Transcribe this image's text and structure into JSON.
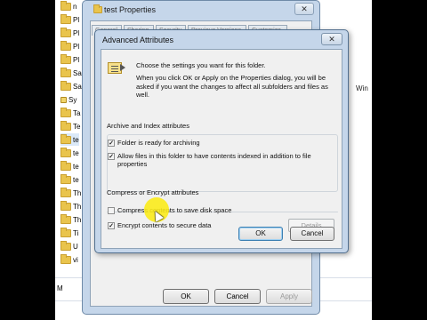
{
  "explorer": {
    "items": [
      {
        "label": "n",
        "icon": "folder"
      },
      {
        "label": "Pl",
        "icon": "folder"
      },
      {
        "label": "Pl",
        "icon": "folder"
      },
      {
        "label": "Pl",
        "icon": "folder"
      },
      {
        "label": "Pl",
        "icon": "folder"
      },
      {
        "label": "Sa",
        "icon": "folder"
      },
      {
        "label": "Sa",
        "icon": "folder"
      },
      {
        "label": "Sy",
        "icon": "lock"
      },
      {
        "label": "Ta",
        "icon": "folder"
      },
      {
        "label": "Te",
        "icon": "folder"
      },
      {
        "label": "te",
        "icon": "folder"
      },
      {
        "label": "te",
        "icon": "folder"
      },
      {
        "label": "te",
        "icon": "folder"
      },
      {
        "label": "te",
        "icon": "folder"
      },
      {
        "label": "Th",
        "icon": "folder"
      },
      {
        "label": "Th",
        "icon": "folder"
      },
      {
        "label": "Th",
        "icon": "folder"
      },
      {
        "label": "Ti",
        "icon": "folder"
      },
      {
        "label": "U",
        "icon": "folder"
      },
      {
        "label": "vi",
        "icon": "folder"
      }
    ],
    "selected_index": 10,
    "bottom_label": "M",
    "right_text": "Win"
  },
  "properties": {
    "title": "test Properties",
    "close_label": "✕",
    "tabs": [
      "General",
      "Sharing",
      "Security",
      "Previous Versions",
      "Customize"
    ],
    "ok_label": "OK",
    "cancel_label": "Cancel",
    "apply_label": "Apply"
  },
  "advanced": {
    "title": "Advanced Attributes",
    "close_label": "✕",
    "intro": "Choose the settings you want for this folder.",
    "description": "When you click OK or Apply on the Properties dialog, you will be asked if you want the changes to affect all subfolders and files as well.",
    "archive_group": {
      "label": "Archive and Index attributes",
      "options": [
        {
          "label": "Folder is ready for archiving",
          "checked": true
        },
        {
          "label": "Allow files in this folder to have contents indexed in addition to file properties",
          "checked": true
        }
      ]
    },
    "compress_group": {
      "label": "Compress or Encrypt attributes",
      "options": [
        {
          "label": "Compress contents to save disk space",
          "checked": false
        },
        {
          "label": "Encrypt contents to secure data",
          "checked": true
        }
      ],
      "details_label": "Details"
    },
    "ok_label": "OK",
    "cancel_label": "Cancel"
  },
  "colors": {
    "window_frame": "#c5d6ea",
    "dialog_bg": "#f0f0f0",
    "cursor_highlight": "#faeb14"
  }
}
